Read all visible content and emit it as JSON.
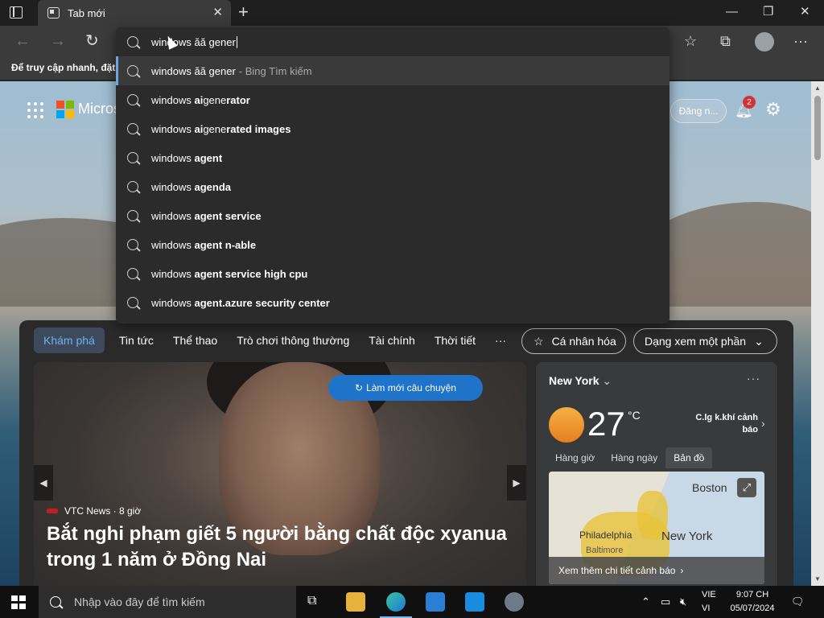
{
  "browser": {
    "tab_title": "Tab mới",
    "favorites_bar_text": "Để truy cập nhanh, đặt r"
  },
  "omnibox": {
    "value": "windows ăă gener",
    "suggestions": [
      {
        "prefix": "windows ăă gener",
        "bold": "",
        "suffix": " - Bing Tìm kiếm"
      },
      {
        "prefix": "windows ",
        "bold": "ai",
        "mid": " gene",
        "bold2": "rator"
      },
      {
        "prefix": "windows ",
        "bold": "ai",
        "mid": " gene",
        "bold2": "rated images"
      },
      {
        "prefix": "windows ",
        "bold": "agent"
      },
      {
        "prefix": "windows ",
        "bold": "agenda"
      },
      {
        "prefix": "windows ",
        "bold": "agent service"
      },
      {
        "prefix": "windows ",
        "bold": "agent n-able"
      },
      {
        "prefix": "windows ",
        "bold": "agent service high cpu"
      },
      {
        "prefix": "windows ",
        "bold": "agent.azure security center"
      }
    ]
  },
  "newtab": {
    "brand": "Micros",
    "signin": "Đăng n...",
    "notifications_count": "2"
  },
  "feed": {
    "nav": [
      "Khám phá",
      "Tin tức",
      "Thể thao",
      "Trò chơi thông thường",
      "Tài chính",
      "Thời tiết",
      "···"
    ],
    "personalize": "Cá nhân hóa",
    "view": "Dạng xem một phần",
    "refresh": "Làm mới câu chuyện",
    "hero": {
      "source": "VTC News · 8 giờ",
      "headline": "Bắt nghi phạm giết 5 người bằng chất độc xyanua trong 1 năm ở Đồng Nai"
    },
    "weather": {
      "city": "New York",
      "temperature": "27",
      "unit": "°C",
      "alert": "C.lg k.khí cảnh báo",
      "tabs": [
        "Hàng giờ",
        "Hàng ngày",
        "Bản đồ"
      ],
      "map_labels": [
        "Boston",
        "Philadelphia",
        "Baltimore",
        "New York"
      ],
      "map_footer": "Xem thêm chi tiết cảnh báo"
    }
  },
  "taskbar": {
    "search_placeholder": "Nhập vào đây để tìm kiếm",
    "lang": "VIE",
    "lang2": "VI",
    "time": "9:07 CH",
    "date": "05/07/2024"
  },
  "colors": {
    "accent": "#1f73c8",
    "nav_active": "#6cb4f0",
    "taskbar": "#101010"
  }
}
